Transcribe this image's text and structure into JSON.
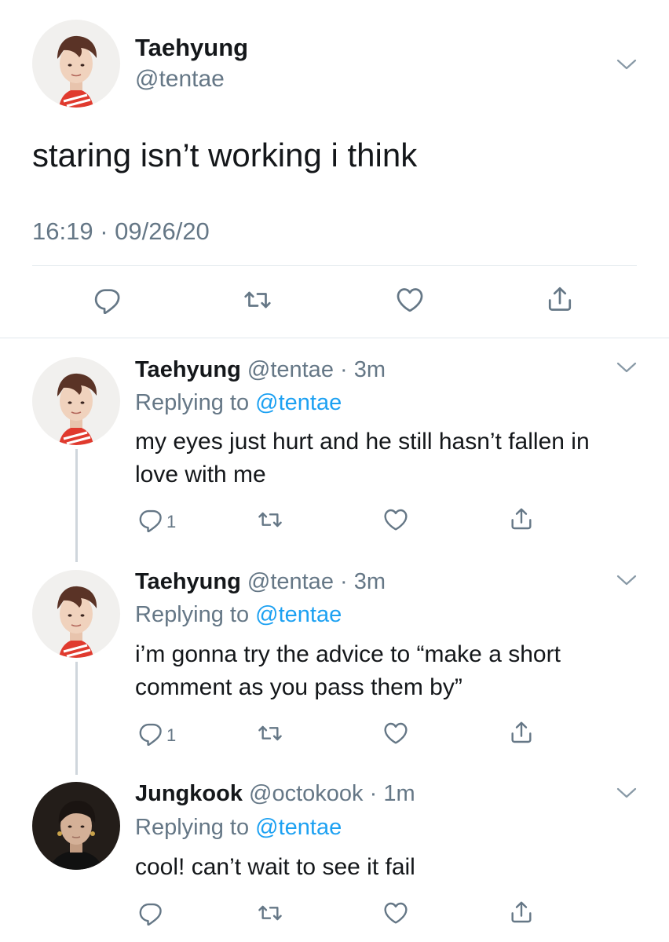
{
  "main_tweet": {
    "name": "Taehyung",
    "handle": "@tentae",
    "text": "staring isn’t working i think",
    "timestamp": "16:19 · 09/26/20",
    "avatar_icon": "avatar-taehyung"
  },
  "replies": [
    {
      "name": "Taehyung",
      "meta": "@tentae · 3m",
      "replying_label": "Replying to",
      "replying_to": "@tentae",
      "body": "my eyes just hurt and he still hasn’t fallen in love with me",
      "reply_count": "1",
      "avatar_icon": "avatar-taehyung"
    },
    {
      "name": "Taehyung",
      "meta": "@tentae · 3m",
      "replying_label": "Replying to",
      "replying_to": "@tentae",
      "body": "i’m gonna try the advice to “make a short comment as you pass them by”",
      "reply_count": "1",
      "avatar_icon": "avatar-taehyung"
    },
    {
      "name": "Jungkook",
      "meta": "@octokook · 1m",
      "replying_label": "Replying to",
      "replying_to": "@tentae",
      "body": "cool! can’t wait to see it fail",
      "avatar_icon": "avatar-jungkook"
    }
  ],
  "icons": {
    "reply": "reply-icon",
    "retweet": "retweet-icon",
    "like": "like-icon",
    "share": "share-icon",
    "more": "chevron-down-icon"
  },
  "colors": {
    "text": "#14171a",
    "secondary": "#657786",
    "link": "#1da1f2",
    "divider": "#e1e8ed",
    "icon": "#657786"
  }
}
